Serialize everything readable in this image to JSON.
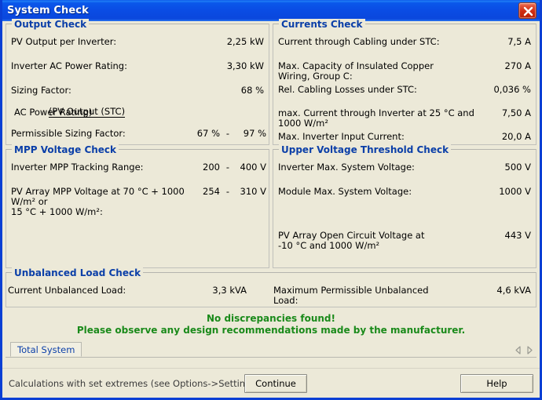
{
  "window": {
    "title": "System Check",
    "close_icon": "close-icon"
  },
  "output_check": {
    "legend": "Output Check",
    "rows": [
      {
        "label": "PV Output per Inverter:",
        "value": "2,25 kW"
      },
      {
        "label": "Inverter AC Power Rating:",
        "value": "3,30 kW"
      }
    ],
    "sizing_factor": {
      "label": "Sizing Factor:",
      "numerator": "(PV Output (STC)",
      "denominator": "AC Power Rating)",
      "value": "68 %"
    },
    "permissible": {
      "label": "Permissible Sizing Factor:",
      "min": "67 %",
      "dash": "-",
      "max": "97 %"
    }
  },
  "currents_check": {
    "legend": "Currents Check",
    "rows": [
      {
        "label": "Current through Cabling under STC:",
        "value": "7,5 A"
      },
      {
        "label": "Max. Capacity of Insulated Copper\nWiring, Group C:",
        "value": "270 A"
      },
      {
        "label": "Rel. Cabling Losses under STC:",
        "value": "0,036 %"
      },
      {
        "label": "max. Current through Inverter at 25 °C and\n1000 W/m²",
        "value": "7,50 A"
      },
      {
        "label": "Max. Inverter Input Current:",
        "value": "20,0 A"
      }
    ]
  },
  "mpp_voltage_check": {
    "legend": "MPP Voltage Check",
    "rows": [
      {
        "label": "Inverter MPP Tracking Range:",
        "min": "200",
        "dash": "-",
        "max": "400 V"
      },
      {
        "label": "PV Array MPP Voltage at 70 °C + 1000 W/m² or\n15 °C + 1000 W/m²:",
        "min": "254",
        "dash": "-",
        "max": "310 V"
      }
    ]
  },
  "upper_voltage_threshold_check": {
    "legend": "Upper Voltage Threshold Check",
    "rows": [
      {
        "label": "Inverter Max. System Voltage:",
        "value": "500 V"
      },
      {
        "label": "Module Max. System Voltage:",
        "value": "1000 V"
      },
      {
        "label": "PV Array Open Circuit Voltage at\n-10 °C and 1000 W/m²",
        "value": "443 V"
      }
    ]
  },
  "unbalanced_load_check": {
    "legend": "Unbalanced Load Check",
    "current": {
      "label": "Current Unbalanced Load:",
      "value": "3,3 kVA"
    },
    "maximum": {
      "label": "Maximum Permissible Unbalanced\nLoad:",
      "value": "4,6 kVA"
    }
  },
  "status": {
    "line1": "No discrepancies found!",
    "line2": "Please observe any design recommendations made by the manufacturer.",
    "color": "#1a8a1a"
  },
  "tabs": {
    "items": [
      {
        "label": "Total System",
        "selected": true
      }
    ],
    "scroll_left_icon": "triangle-left-icon",
    "scroll_right_icon": "triangle-right-icon"
  },
  "bottom": {
    "hint": "Calculations with set extremes (see Options->Settings)",
    "continue_label": "Continue",
    "help_label": "Help"
  }
}
